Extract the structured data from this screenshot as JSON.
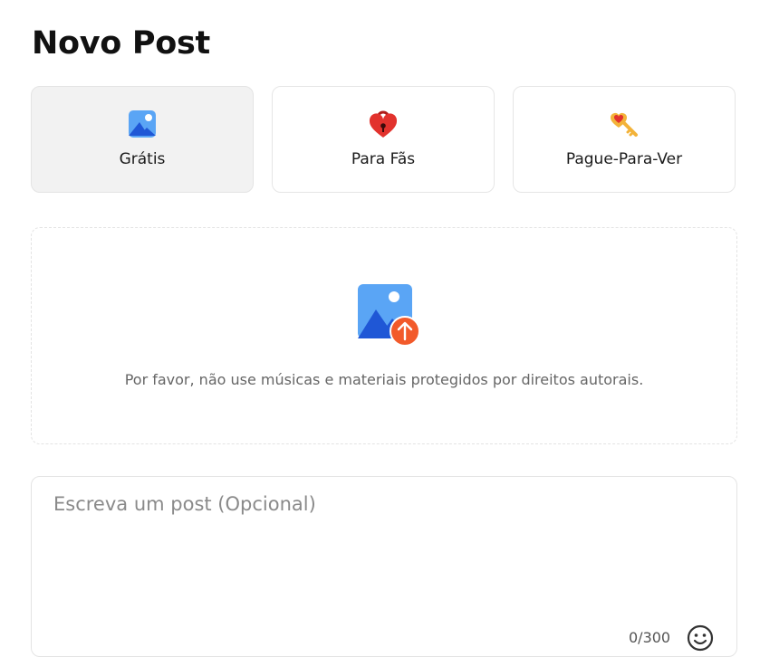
{
  "page": {
    "title": "Novo Post"
  },
  "tabs": [
    {
      "label": "Grátis",
      "icon": "image-icon",
      "active": true
    },
    {
      "label": "Para Fãs",
      "icon": "heart-lock-icon",
      "active": false
    },
    {
      "label": "Pague-Para-Ver",
      "icon": "heart-key-icon",
      "active": false
    }
  ],
  "upload": {
    "icon": "image-upload-icon",
    "note": "Por favor, não use músicas e materiais protegidos por direitos autorais."
  },
  "post": {
    "placeholder": "Escreva um post (Opcional)",
    "counter": "0/300",
    "emoji_icon": "smiley-icon"
  },
  "colors": {
    "accent_blue": "#1f57d6",
    "light_blue": "#5aa5f5",
    "upload_orange": "#f25a2b",
    "lock_red": "#e2322d",
    "key_gold": "#f3b33a"
  }
}
